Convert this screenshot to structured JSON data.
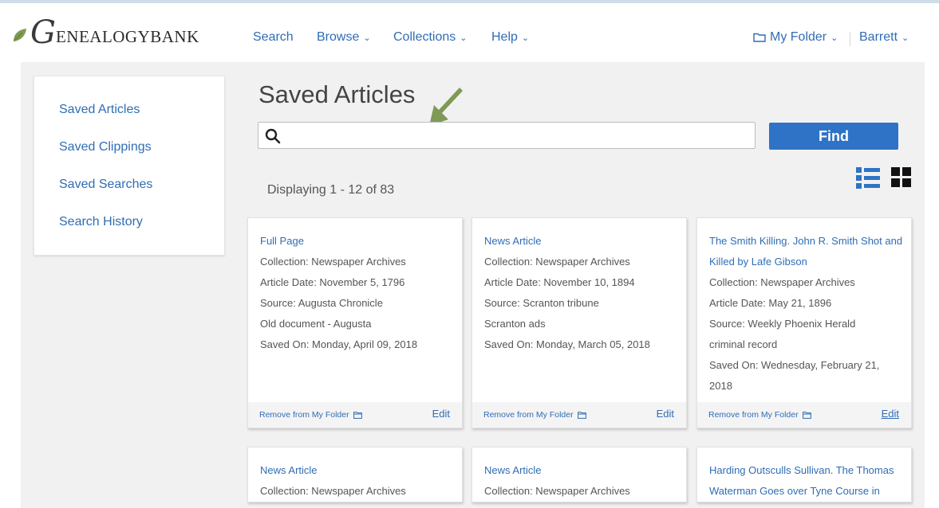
{
  "brand": {
    "logo_initial": "G",
    "logo_rest": "ENEALOGYBANK"
  },
  "nav": {
    "search": "Search",
    "browse": "Browse",
    "collections": "Collections",
    "help": "Help",
    "my_folder": "My Folder",
    "user": "Barrett"
  },
  "sidebar": {
    "items": [
      {
        "label": "Saved Articles"
      },
      {
        "label": "Saved Clippings"
      },
      {
        "label": "Saved Searches"
      },
      {
        "label": "Search History"
      }
    ]
  },
  "main": {
    "title": "Saved Articles",
    "search_placeholder": "",
    "find_label": "Find",
    "display_count": "Displaying 1 - 12 of 83"
  },
  "cards": [
    {
      "title": "Full Page",
      "lines": [
        "Collection: Newspaper Archives",
        "Article Date: November 5, 1796",
        "Source: Augusta Chronicle",
        "Old document - Augusta",
        "Saved On: Monday, April 09, 2018"
      ],
      "remove_label": "Remove from My Folder",
      "edit_label": "Edit"
    },
    {
      "title": "News Article",
      "lines": [
        "Collection: Newspaper Archives",
        "Article Date: November 10, 1894",
        "Source: Scranton tribune",
        "Scranton ads",
        "Saved On: Monday, March 05, 2018"
      ],
      "remove_label": "Remove from My Folder",
      "edit_label": "Edit"
    },
    {
      "title": "The Smith Killing. John R. Smith Shot and Killed by Lafe Gibson",
      "lines": [
        "Collection: Newspaper Archives",
        "Article Date: May 21, 1896",
        "Source: Weekly Phoenix Herald",
        "criminal record",
        "Saved On: Wednesday, February 21, 2018"
      ],
      "remove_label": "Remove from My Folder",
      "edit_label": "Edit"
    },
    {
      "title": "News Article",
      "lines": [
        "Collection: Newspaper Archives"
      ]
    },
    {
      "title": "News Article",
      "lines": [
        "Collection: Newspaper Archives"
      ]
    },
    {
      "title": "Harding Outsculls Sullivan. The Thomas Waterman Goes over Tyne Course in",
      "lines": []
    }
  ],
  "colors": {
    "link": "#2f6db5",
    "button": "#2e73c6",
    "arrow": "#7f9a55"
  }
}
